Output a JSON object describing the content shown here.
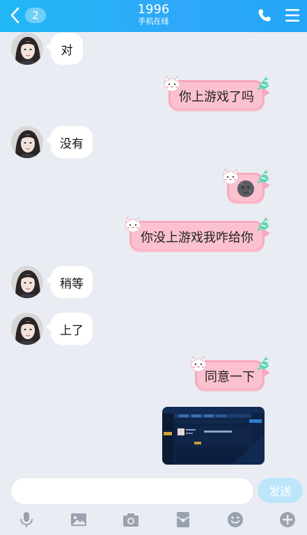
{
  "header": {
    "back_count": "2",
    "title": "1996",
    "subtitle": "手机在线"
  },
  "messages": [
    {
      "side": "in",
      "text": "对"
    },
    {
      "side": "out",
      "text": "你上游戏了吗"
    },
    {
      "side": "in",
      "text": "没有"
    },
    {
      "side": "out",
      "emoji": "new-moon-face"
    },
    {
      "side": "out",
      "text": "你没上游戏我咋给你"
    },
    {
      "side": "in",
      "text": "稍等"
    },
    {
      "side": "in",
      "text": "上了"
    },
    {
      "side": "out",
      "text": "同意一下"
    },
    {
      "side": "out",
      "image": "game-screenshot"
    }
  ],
  "composer": {
    "placeholder": "",
    "send_label": "发送"
  },
  "toolbar": [
    "microphone-icon",
    "image-icon",
    "camera-icon",
    "red-packet-icon",
    "emoji-icon",
    "plus-icon"
  ],
  "colors": {
    "header": "#23a8f8",
    "outgoing_bubble": "#f7a9be",
    "incoming_bubble": "#ffffff",
    "background": "#e9edf3",
    "send_button": "#bde6fb"
  }
}
